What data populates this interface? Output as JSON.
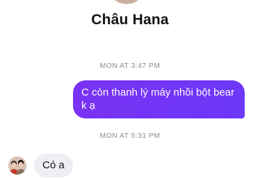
{
  "contact": {
    "name": "Châu Hana"
  },
  "messages": [
    {
      "type": "timestamp",
      "text": "MON AT 3:47 PM"
    },
    {
      "type": "outgoing",
      "text": "C còn thanh lý máy nhồi bột bear k ạ"
    },
    {
      "type": "timestamp",
      "text": "MON AT 5:31 PM"
    },
    {
      "type": "incoming",
      "text": "Có a"
    }
  ],
  "colors": {
    "outgoing_bubble": "#7a32f4",
    "incoming_bubble": "#eeeff2",
    "timestamp_text": "#8a8d91"
  }
}
